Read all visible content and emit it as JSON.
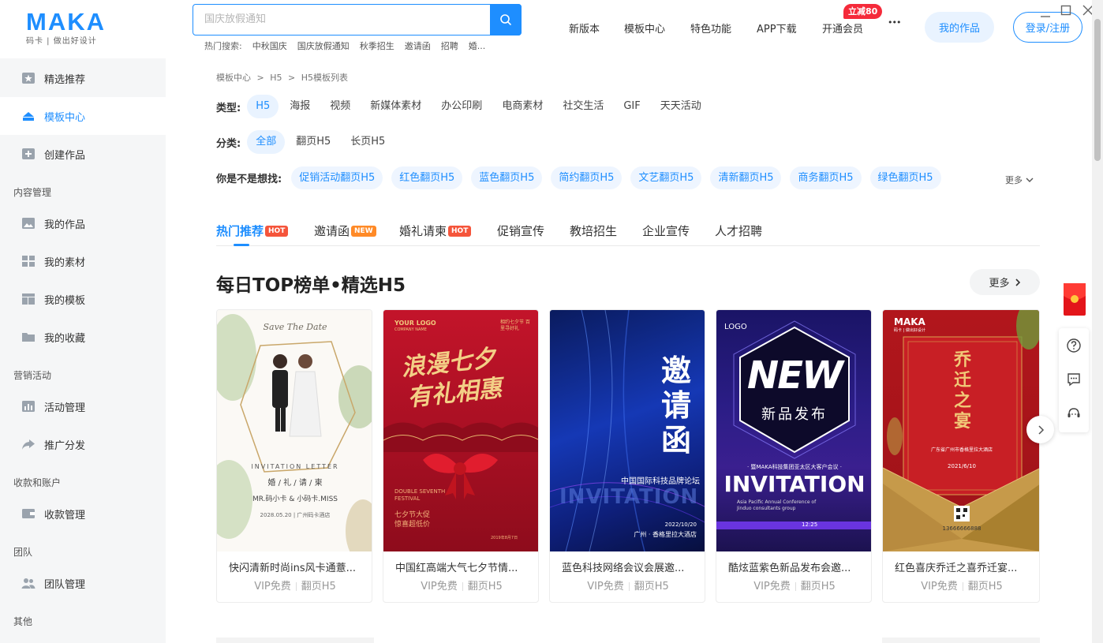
{
  "brand": {
    "name": "MAKA",
    "tagline": "码卡 | 做出好设计"
  },
  "search": {
    "placeholder": "国庆放假通知",
    "hot_label": "热门搜索:",
    "hot_keywords": [
      "中秋国庆",
      "国庆放假通知",
      "秋季招生",
      "邀请函",
      "招聘",
      "婚..."
    ]
  },
  "nav": {
    "items": [
      "新版本",
      "模板中心",
      "特色功能",
      "APP下载",
      "开通会员"
    ],
    "more": "•••",
    "promo_badge": "立减80",
    "my_works": "我的作品",
    "login": "登录/注册"
  },
  "sidebar": {
    "items": [
      {
        "label": "精选推荐",
        "icon": "star-icon"
      },
      {
        "label": "模板中心",
        "icon": "template-icon",
        "active": true
      },
      {
        "label": "创建作品",
        "icon": "plus-icon"
      }
    ],
    "groups": [
      {
        "title": "内容管理",
        "items": [
          "我的作品",
          "我的素材",
          "我的模板",
          "我的收藏"
        ]
      },
      {
        "title": "营销活动",
        "items": [
          "活动管理",
          "推广分发"
        ]
      },
      {
        "title": "收款和账户",
        "items": [
          "收款管理"
        ]
      },
      {
        "title": "团队",
        "items": [
          "团队管理"
        ]
      },
      {
        "title": "其他",
        "items": []
      }
    ]
  },
  "breadcrumb": [
    "模板中心",
    "H5",
    "H5模板列表"
  ],
  "filters": {
    "type_label": "类型:",
    "types": [
      "H5",
      "海报",
      "视频",
      "新媒体素材",
      "办公印刷",
      "电商素材",
      "社交生活",
      "GIF",
      "天天活动"
    ],
    "category_label": "分类:",
    "categories": [
      "全部",
      "翻页H5",
      "长页H5"
    ],
    "suggest_label": "你是不是想找:",
    "suggestions": [
      "促销活动翻页H5",
      "红色翻页H5",
      "蓝色翻页H5",
      "简约翻页H5",
      "文艺翻页H5",
      "清新翻页H5",
      "商务翻页H5",
      "绿色翻页H5"
    ],
    "more": "更多"
  },
  "tabs": [
    {
      "label": "热门推荐",
      "tag": "HOT"
    },
    {
      "label": "邀请函",
      "tag": "NEW"
    },
    {
      "label": "婚礼请柬",
      "tag": "HOT"
    },
    {
      "label": "促销宣传",
      "tag": ""
    },
    {
      "label": "教培招生",
      "tag": ""
    },
    {
      "label": "企业宣传",
      "tag": ""
    },
    {
      "label": "人才招聘",
      "tag": ""
    }
  ],
  "section": {
    "title": "每日TOP榜单•精选H5",
    "more": "更多"
  },
  "cards": [
    {
      "title": "快闪清新时尚ins风卡通薏...",
      "vip": "VIP免费",
      "kind": "翻页H5",
      "texts": {
        "script": "Save The Date",
        "invite": "INVITATION LETTER",
        "cn": "婚 / 礼 / 请 / 柬",
        "names": "MR.码小卡  &  小码卡.MISS",
        "date": "2028.05.20 | 广州码卡酒店"
      }
    },
    {
      "title": "中国红高端大气七夕节情...",
      "vip": "VIP免费",
      "kind": "翻页H5",
      "texts": {
        "logo": "YOUR LOGO",
        "logo_sub": "COMPANY NAME",
        "corner": "相约七夕节 百里寻好礼",
        "headline1": "浪漫七夕",
        "headline2": "有礼相惠",
        "en": "DOUBLE SEVENTH FESTIVAL",
        "sale": "七夕节大促",
        "sale2": "惊喜超低价",
        "foot": "2019年8月7日"
      }
    },
    {
      "title": "蓝色科技网络会议会展邀...",
      "vip": "VIP免费",
      "kind": "翻页H5",
      "texts": {
        "big": "邀请函",
        "forum": "中国国际科技品牌论坛",
        "en": "INVITATION",
        "date": "2022/10/20",
        "place": "广州 · 香格里拉大酒店"
      }
    },
    {
      "title": "酷炫蓝紫色新品发布会邀...",
      "vip": "VIP免费",
      "kind": "翻页H5",
      "texts": {
        "logo": "LOGO",
        "new": "NEW",
        "launch": "新品发布",
        "meet": "· 暨MAKA科技集团亚太区大客户会议 ·",
        "en": "INVITATION",
        "sub": "Asia Pacific Annual Conference of Jinduo consultants group",
        "time": "12:25"
      }
    },
    {
      "title": "红色喜庆乔迁之喜乔迁宴...",
      "vip": "VIP免费",
      "kind": "翻页H5",
      "texts": {
        "logo": "MAKA",
        "logo_sub": "码卡 | 做出好设计",
        "big": "乔迁之宴",
        "place": "广东省广州市香格里拉大酒店",
        "date": "2021/6/10",
        "phone": "13666666888"
      }
    }
  ]
}
